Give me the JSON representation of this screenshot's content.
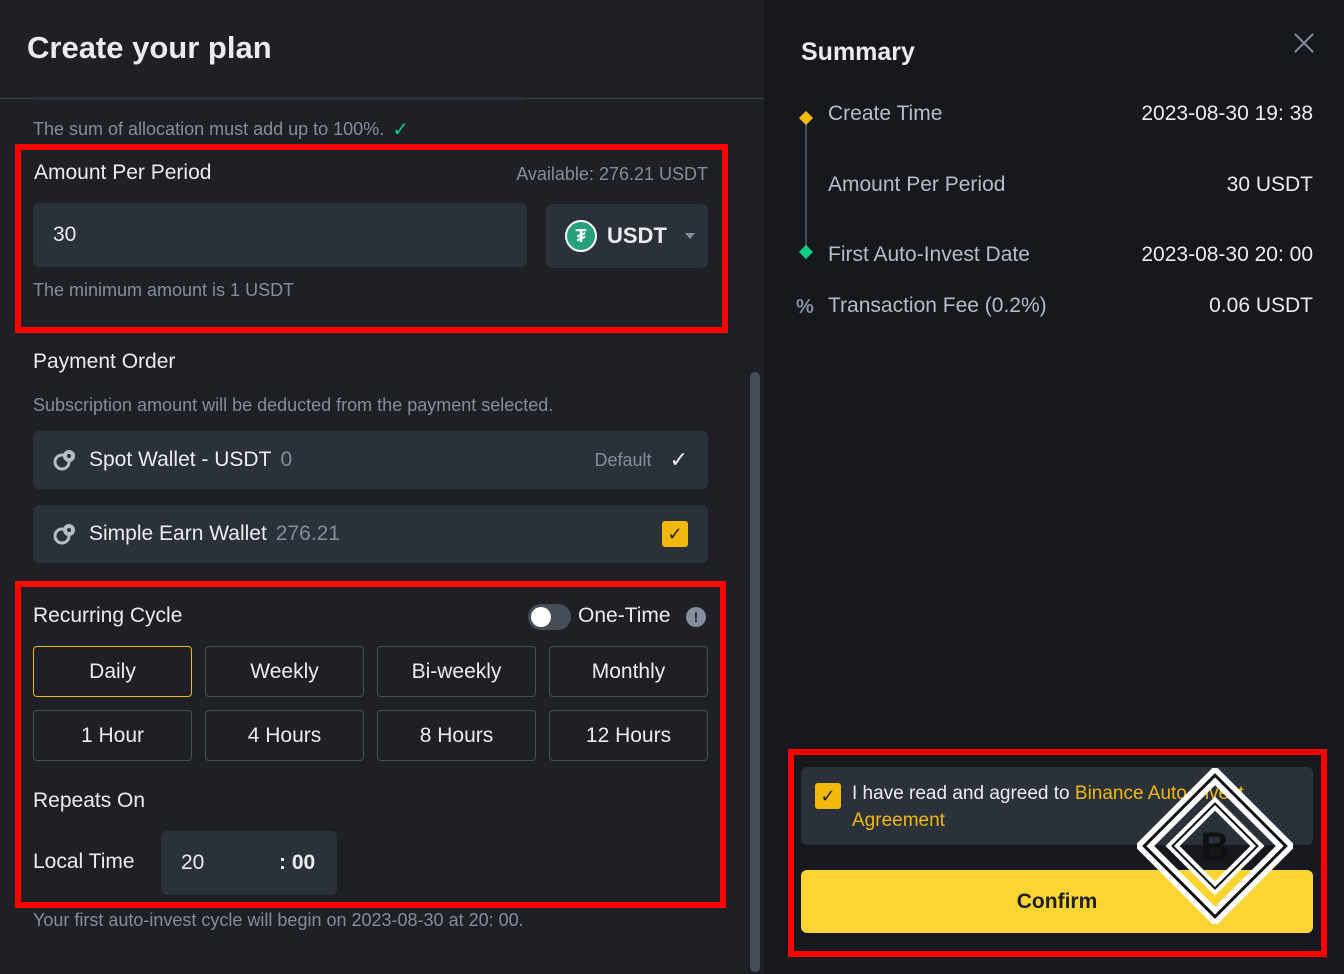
{
  "plan": {
    "title": "Create your plan",
    "allocation_note": "The sum of allocation must add up to 100%.",
    "amount": {
      "label": "Amount Per Period",
      "available": "Available: 276.21 USDT",
      "value": "30",
      "currency": "USDT",
      "min_note": "The minimum amount is 1 USDT"
    },
    "payment": {
      "label": "Payment Order",
      "note": "Subscription amount will be deducted from the payment selected.",
      "wallets": [
        {
          "name": "Spot Wallet - USDT",
          "amount": "0",
          "tag": "Default"
        },
        {
          "name": "Simple Earn Wallet",
          "amount": "276.21"
        }
      ]
    },
    "cycle": {
      "label": "Recurring Cycle",
      "one_time_label": "One-Time",
      "one_time_enabled": false,
      "options": [
        "Daily",
        "Weekly",
        "Bi-weekly",
        "Monthly",
        "1 Hour",
        "4 Hours",
        "8 Hours",
        "12 Hours"
      ],
      "selected": "Daily",
      "repeats_label": "Repeats On",
      "local_time_label": "Local Time",
      "hour": "20",
      "minute": ": 00",
      "first_cycle_note": "Your first auto-invest cycle will begin on 2023-08-30 at 20: 00."
    }
  },
  "summary": {
    "title": "Summary",
    "rows": [
      {
        "label": "Create Time",
        "value": "2023-08-30 19: 38"
      },
      {
        "label": "Amount Per Period",
        "value": "30 USDT"
      },
      {
        "label": "First Auto-Invest Date",
        "value": "2023-08-30 20: 00"
      },
      {
        "label": "Transaction Fee (0.2%)",
        "value": "0.06 USDT"
      }
    ],
    "agreement_prefix": "I have read and agreed to ",
    "agreement_link": "Binance Auto-Invest Agreement",
    "confirm_label": "Confirm",
    "watermark_letter": "B"
  },
  "colors": {
    "accent": "#f0b90b",
    "confirm": "#fcd535",
    "success": "#0ecb81",
    "highlight": "#ff0000"
  }
}
